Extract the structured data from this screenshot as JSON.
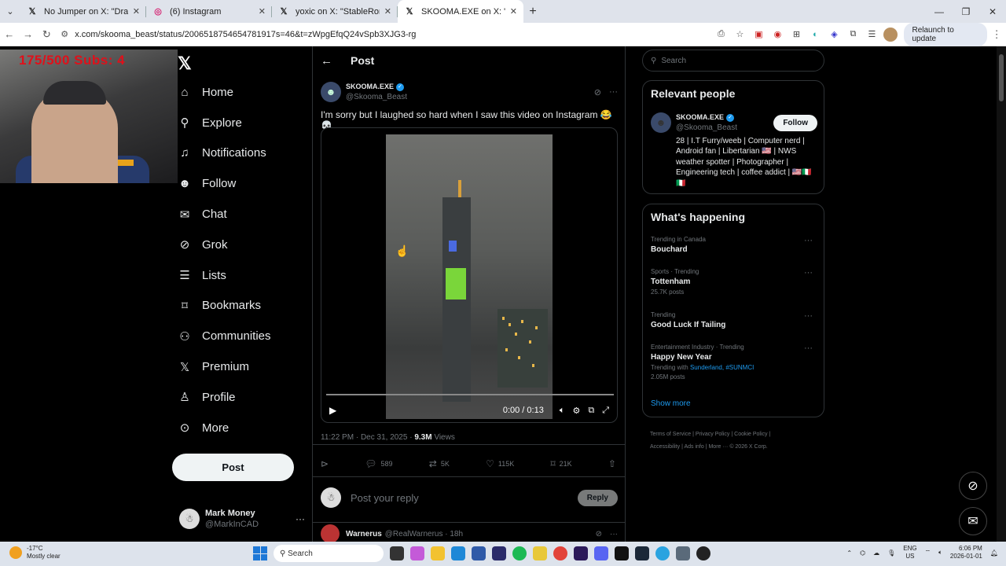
{
  "browser": {
    "tabs": [
      {
        "title": "No Jumper on X: \"Drake &amp",
        "icon": "x-icon"
      },
      {
        "title": "(6) Instagram",
        "icon": "instagram-icon"
      },
      {
        "title": "yoxic on X: \"StableRonaldo just",
        "icon": "x-icon"
      },
      {
        "title": "SKOOMA.EXE on X: \"I'm sorry bu",
        "icon": "x-icon"
      }
    ],
    "url": "x.com/skooma_beast/status/2006518754654781917s=46&t=zWpgEfqQ24vSpb3XJG3-rg",
    "relaunch_label": "Relaunch to update"
  },
  "overlay": {
    "counter_text": "175/500  Subs: 4"
  },
  "nav": {
    "items": [
      {
        "label": "Home",
        "icon": "home-icon",
        "glyph": "⌂"
      },
      {
        "label": "Explore",
        "icon": "search-icon",
        "glyph": "⚲"
      },
      {
        "label": "Notifications",
        "icon": "bell-icon",
        "glyph": "🔔︎"
      },
      {
        "label": "Follow",
        "icon": "add-person-icon",
        "glyph": "👤︎"
      },
      {
        "label": "Chat",
        "icon": "mail-icon",
        "glyph": "✉"
      },
      {
        "label": "Grok",
        "icon": "grok-icon",
        "glyph": "⊘"
      },
      {
        "label": "Lists",
        "icon": "list-icon",
        "glyph": "☰"
      },
      {
        "label": "Bookmarks",
        "icon": "bookmark-icon",
        "glyph": "🔖︎"
      },
      {
        "label": "Communities",
        "icon": "people-icon",
        "glyph": "👥︎"
      },
      {
        "label": "Premium",
        "icon": "x-icon",
        "glyph": "𝕏"
      },
      {
        "label": "Profile",
        "icon": "person-icon",
        "glyph": "👤︎"
      },
      {
        "label": "More",
        "icon": "more-circle-icon",
        "glyph": "⋯"
      }
    ],
    "post_label": "Post",
    "me": {
      "name": "Mark Money",
      "handle": "@MarkInCAD"
    }
  },
  "post": {
    "header_title": "Post",
    "author_name": "SKOOMA.EXE",
    "author_handle": "@Skooma_Beast",
    "text": "I'm sorry but I laughed so hard when I saw this video on Instagram 😂💀",
    "video_time": "0:00 / 0:13",
    "timestamp": "11:22 PM · Dec 31, 2025 · ",
    "views_count": "9.3M",
    "views_label": " Views",
    "stats": {
      "replies": "589",
      "reposts": "5K",
      "likes": "115K",
      "bookmarks": "21K"
    },
    "reply_placeholder": "Post your reply",
    "reply_label": "Reply",
    "next_reply": {
      "name": "Warnerus",
      "handle": "@RealWarnerus · 18h"
    }
  },
  "sidebar": {
    "search_placeholder": "Search",
    "relevant_title": "Relevant people",
    "relevant_user": {
      "name": "SKOOMA.EXE",
      "handle": "@Skooma_Beast",
      "follow_label": "Follow",
      "bio": "28 | I.T Furry/weeb | Computer nerd | Android fan | Libertarian 🇺🇸 | NWS weather spotter | Photographer | Engineering tech | coffee addict | 🇺🇸🇮🇹🇮🇹"
    },
    "happening_title": "What's happening",
    "trends": [
      {
        "category": "Trending in Canada",
        "name": "Bouchard",
        "sub": ""
      },
      {
        "category": "Sports · Trending",
        "name": "Tottenham",
        "sub": "25.7K posts"
      },
      {
        "category": "Trending",
        "name": "Good Luck If Tailing",
        "sub": ""
      },
      {
        "category": "Entertainment Industry · Trending",
        "name": "Happy New Year",
        "sub_prefix": "Trending with ",
        "sub_links": "Sunderland, #SUNMCI",
        "sub": "2.05M posts"
      }
    ],
    "show_more": "Show more",
    "footer": [
      "Terms of Service",
      "Privacy Policy",
      "Cookie Policy",
      "Accessibility",
      "Ads info",
      "More ···",
      "© 2026 X Corp."
    ]
  },
  "taskbar": {
    "weather_temp": "-17°C",
    "weather_desc": "Mostly clear",
    "search_label": "Search",
    "lang_top": "ENG",
    "lang_bottom": "US",
    "time": "6:06 PM",
    "date": "2026-01-01"
  },
  "colors": {
    "accent": "#1d9bf0",
    "background": "#000000",
    "border": "#2f3336"
  }
}
